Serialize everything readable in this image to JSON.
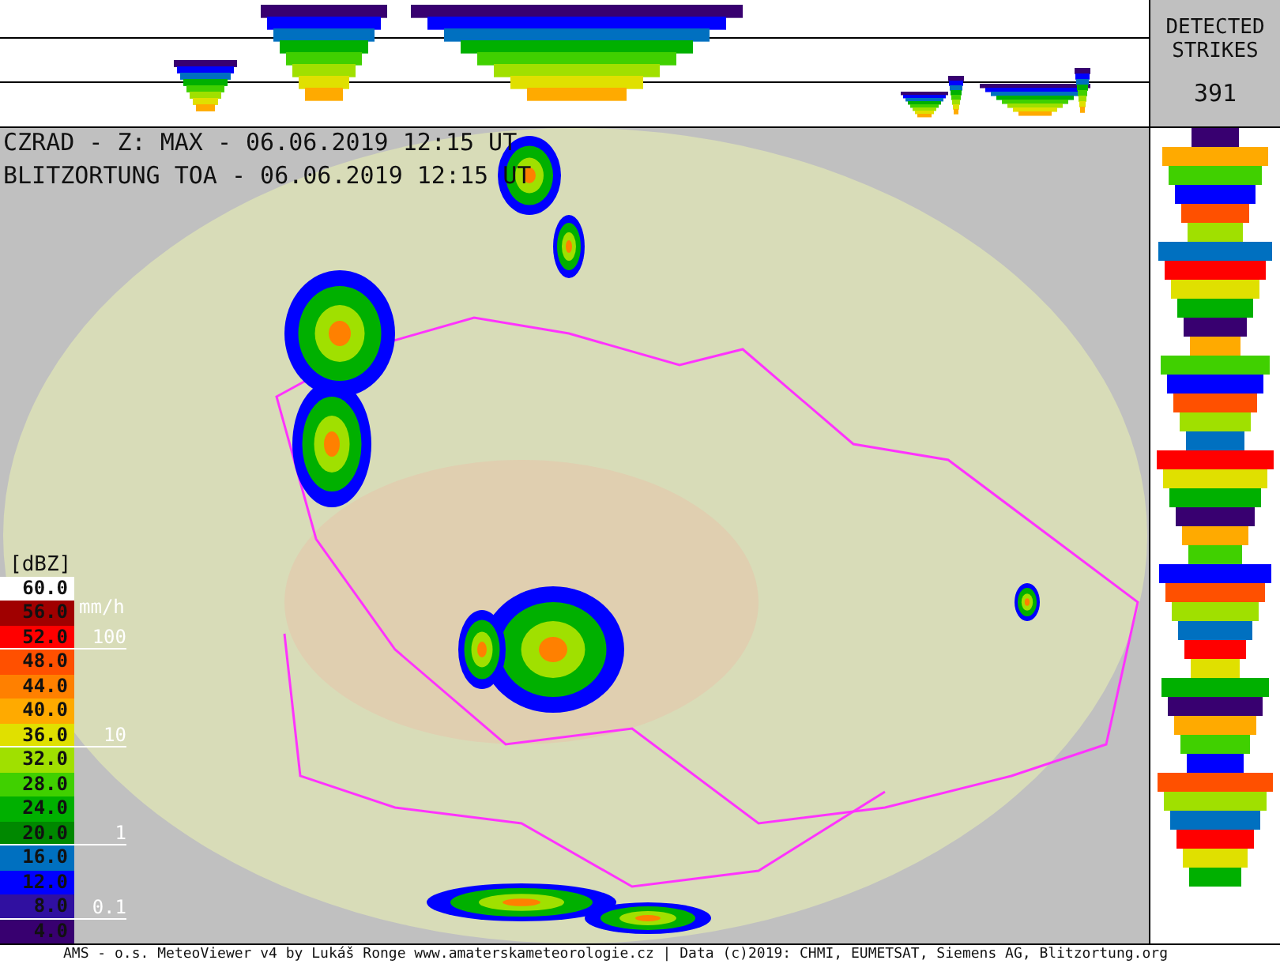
{
  "header": {
    "radar_line": "CZRAD - Z: MAX - 06.06.2019 12:15 UT",
    "lightning_line": "BLITZORTUNG TOA - 06.06.2019 12:15 UT"
  },
  "strikes": {
    "label": "DETECTED STRIKES",
    "count": "391"
  },
  "legend": {
    "unit": "[dBZ]",
    "rain_unit": "mm/h",
    "scale": [
      {
        "label": "60.0",
        "color": "#ffffff"
      },
      {
        "label": "56.0",
        "color": "#a00000"
      },
      {
        "label": "52.0",
        "color": "#ff0000"
      },
      {
        "label": "48.0",
        "color": "#ff5000"
      },
      {
        "label": "44.0",
        "color": "#ff8000"
      },
      {
        "label": "40.0",
        "color": "#ffaa00"
      },
      {
        "label": "36.0",
        "color": "#e0e000"
      },
      {
        "label": "32.0",
        "color": "#a0e000"
      },
      {
        "label": "28.0",
        "color": "#40d000"
      },
      {
        "label": "24.0",
        "color": "#00b000"
      },
      {
        "label": "20.0",
        "color": "#008800"
      },
      {
        "label": "16.0",
        "color": "#0070c0"
      },
      {
        "label": "12.0",
        "color": "#0000ff"
      },
      {
        "label": "8.0",
        "color": "#3010a0"
      },
      {
        "label": "4.0",
        "color": "#380070"
      }
    ],
    "rain_marks": [
      "100",
      "10",
      "1",
      "0.1"
    ]
  },
  "footer": "AMS - o.s. MeteoViewer v4 by Lukáš Ronge www.amaterskameteorologie.cz | Data (c)2019: CHMI, EUMETSAT, Siemens AG, Blitzortung.org"
}
